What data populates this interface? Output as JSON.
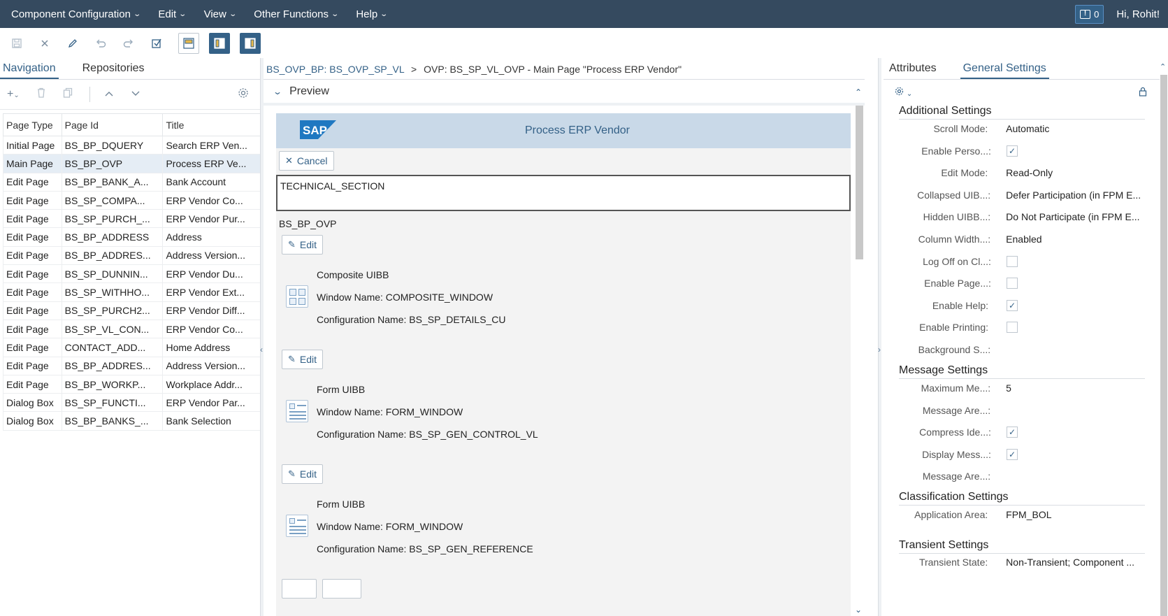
{
  "menubar": {
    "items": [
      "Component Configuration",
      "Edit",
      "View",
      "Other Functions",
      "Help"
    ],
    "notification_count": "0",
    "greeting": "Hi, Rohit!"
  },
  "toolbar": {
    "icons": [
      "save-icon",
      "close-icon",
      "pencil-icon",
      "undo-icon",
      "redo-icon",
      "check-icon",
      "layout-top-icon",
      "layout-left-icon",
      "layout-right-icon"
    ]
  },
  "nav": {
    "tabs": [
      "Navigation",
      "Repositories"
    ],
    "columns": [
      "Page Type",
      "Page Id",
      "Title"
    ],
    "rows": [
      [
        "Initial Page",
        "BS_BP_DQUERY",
        "Search ERP Ven..."
      ],
      [
        "Main Page",
        "BS_BP_OVP",
        "Process ERP Ve..."
      ],
      [
        "Edit Page",
        "BS_BP_BANK_A...",
        "Bank Account"
      ],
      [
        "Edit Page",
        "BS_SP_COMPA...",
        "ERP Vendor Co..."
      ],
      [
        "Edit Page",
        "BS_SP_PURCH_...",
        "ERP Vendor Pur..."
      ],
      [
        "Edit Page",
        "BS_BP_ADDRESS",
        "Address"
      ],
      [
        "Edit Page",
        "BS_BP_ADDRES...",
        "Address Version..."
      ],
      [
        "Edit Page",
        "BS_SP_DUNNIN...",
        "ERP Vendor Du..."
      ],
      [
        "Edit Page",
        "BS_SP_WITHHO...",
        "ERP Vendor Ext..."
      ],
      [
        "Edit Page",
        "BS_SP_PURCH2...",
        "ERP Vendor Diff..."
      ],
      [
        "Edit Page",
        "BS_SP_VL_CON...",
        "ERP Vendor Co..."
      ],
      [
        "Edit Page",
        "CONTACT_ADD...",
        "Home Address"
      ],
      [
        "Edit Page",
        "BS_BP_ADDRES...",
        "Address Version..."
      ],
      [
        "Edit Page",
        "BS_BP_WORKP...",
        "Workplace Addr..."
      ],
      [
        "Dialog Box",
        "BS_SP_FUNCTI...",
        "ERP Vendor Par..."
      ],
      [
        "Dialog Box",
        "BS_BP_BANKS_...",
        "Bank Selection"
      ]
    ],
    "selected_row": 1
  },
  "center": {
    "breadcrumb_link": "BS_OVP_BP: BS_OVP_SP_VL",
    "breadcrumb_sep": ">",
    "breadcrumb_current": "OVP: BS_SP_VL_OVP - Main Page \"Process ERP Vendor\"",
    "preview_label": "Preview",
    "sap_logo": "SAP",
    "app_title": "Process ERP Vendor",
    "cancel_label": "Cancel",
    "technical_section": "TECHNICAL_SECTION",
    "section_id": "BS_BP_OVP",
    "edit_label": "Edit",
    "uibbs": [
      {
        "type": "Composite UIBB",
        "window": "Window Name: COMPOSITE_WINDOW",
        "config": "Configuration Name: BS_SP_DETAILS_CU"
      },
      {
        "type": "Form UIBB",
        "window": "Window Name: FORM_WINDOW",
        "config": "Configuration Name: BS_SP_GEN_CONTROL_VL"
      },
      {
        "type": "Form UIBB",
        "window": "Window Name: FORM_WINDOW",
        "config": "Configuration Name: BS_SP_GEN_REFERENCE"
      }
    ]
  },
  "attrs": {
    "tabs": [
      "Attributes",
      "General Settings"
    ],
    "additional_title": "Additional Settings",
    "additional": [
      {
        "label": "Scroll Mode:",
        "value": "Automatic"
      },
      {
        "label": "Enable Perso...",
        "checkbox": true
      },
      {
        "label": "Edit Mode:",
        "value": "Read-Only"
      },
      {
        "label": "Collapsed UIB...",
        "value": "Defer Participation (in FPM E..."
      },
      {
        "label": "Hidden UIBB...",
        "value": "Do Not Participate (in FPM E..."
      },
      {
        "label": "Column Width...",
        "value": "Enabled"
      },
      {
        "label": "Log Off on Cl...",
        "checkbox": false
      },
      {
        "label": "Enable Page...",
        "checkbox": false
      },
      {
        "label": "Enable Help:",
        "checkbox": true
      },
      {
        "label": "Enable Printing:",
        "checkbox": false
      },
      {
        "label": "Background S...",
        "value": ""
      }
    ],
    "message_title": "Message Settings",
    "message": [
      {
        "label": "Maximum Me...",
        "value": "5"
      },
      {
        "label": "Message Are...",
        "value": ""
      },
      {
        "label": "Compress Ide...",
        "checkbox": true
      },
      {
        "label": "Display Mess...",
        "checkbox": true
      },
      {
        "label": "Message Are...",
        "value": ""
      }
    ],
    "classification_title": "Classification Settings",
    "classification": [
      {
        "label": "Application Area:",
        "value": "FPM_BOL"
      }
    ],
    "transient_title": "Transient Settings",
    "transient": [
      {
        "label": "Transient State:",
        "value": "Non-Transient; Component ..."
      }
    ]
  },
  "colors": {
    "menubar": "#354a5f",
    "accent": "#346187",
    "sap_bar": "#c9d9e8"
  }
}
